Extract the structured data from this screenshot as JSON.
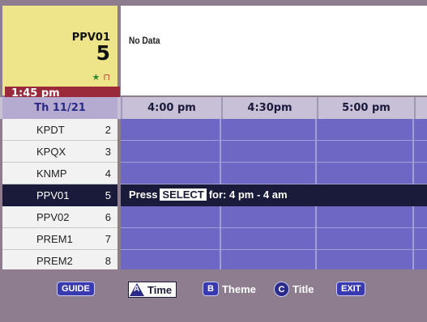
{
  "info": {
    "callsign": "PPV01",
    "channel": "5",
    "time": "1:45 pm",
    "icons": [
      "star-icon",
      "lock-icon"
    ]
  },
  "description": {
    "text": "No Data"
  },
  "time_header": {
    "date": "Th 11/21",
    "slots": [
      "4:00 pm",
      "4:30pm",
      "5:00 pm"
    ]
  },
  "channels": [
    {
      "name": "KPDT",
      "number": "2"
    },
    {
      "name": "KPQX",
      "number": "3"
    },
    {
      "name": "KNMP",
      "number": "4"
    },
    {
      "name": "PPV01",
      "number": "5"
    },
    {
      "name": "PPV02",
      "number": "6"
    },
    {
      "name": "PREM1",
      "number": "7"
    },
    {
      "name": "PREM2",
      "number": "8"
    }
  ],
  "selected_row": {
    "press": "Press",
    "key": "SELECT",
    "suffix": "for:  4 pm - 4 am"
  },
  "controls": {
    "guide": "GUIDE",
    "time_key": "A",
    "time": "Time",
    "theme_key": "B",
    "theme": "Theme",
    "title_key": "C",
    "title": "Title",
    "exit": "EXIT"
  },
  "colors": {
    "info_bg": "#eee58a",
    "time_bar": "#9a2a3a",
    "grid_cell": "#6e68c4",
    "selected_row": "#1a1a3a",
    "footer": "#8e7d8f"
  }
}
